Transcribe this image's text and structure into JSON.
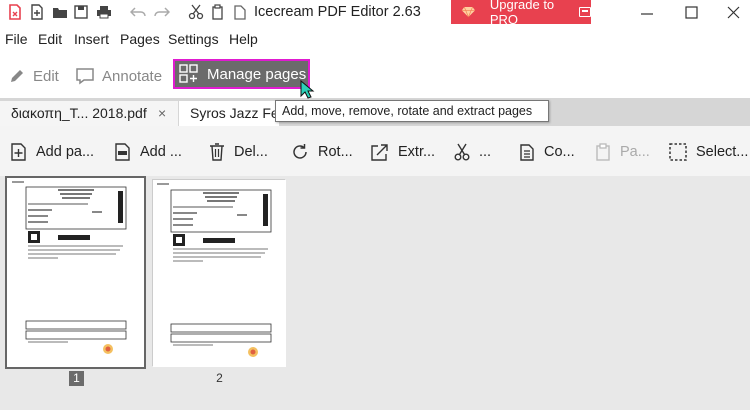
{
  "titlebar": {
    "app_title": "Icecream PDF Editor 2.63",
    "upgrade_label": "Upgrade to PRO",
    "accent_color": "#e8414f"
  },
  "menu": [
    "File",
    "Edit",
    "Insert",
    "Pages",
    "Settings",
    "Help"
  ],
  "toolbar": {
    "edit_label": "Edit",
    "annotate_label": "Annotate",
    "manage_label": "Manage pages",
    "highlight_color": "#e01bd0"
  },
  "tabs": [
    {
      "label": "διακοπη_Τ... 2018.pdf",
      "close": "×"
    },
    {
      "label": "Syros Jazz Fes"
    }
  ],
  "tooltip": "Add, move, remove, rotate and extract pages",
  "page_toolbar": {
    "add_page": "Add pa...",
    "add_file": "Add ...",
    "delete": "Del...",
    "rotate": "Rot...",
    "extract": "Extr...",
    "cut": "...",
    "copy": "Co...",
    "paste": "Pa...",
    "select": "Select..."
  },
  "pages": [
    {
      "number": "1",
      "selected": true
    },
    {
      "number": "2",
      "selected": false
    }
  ]
}
